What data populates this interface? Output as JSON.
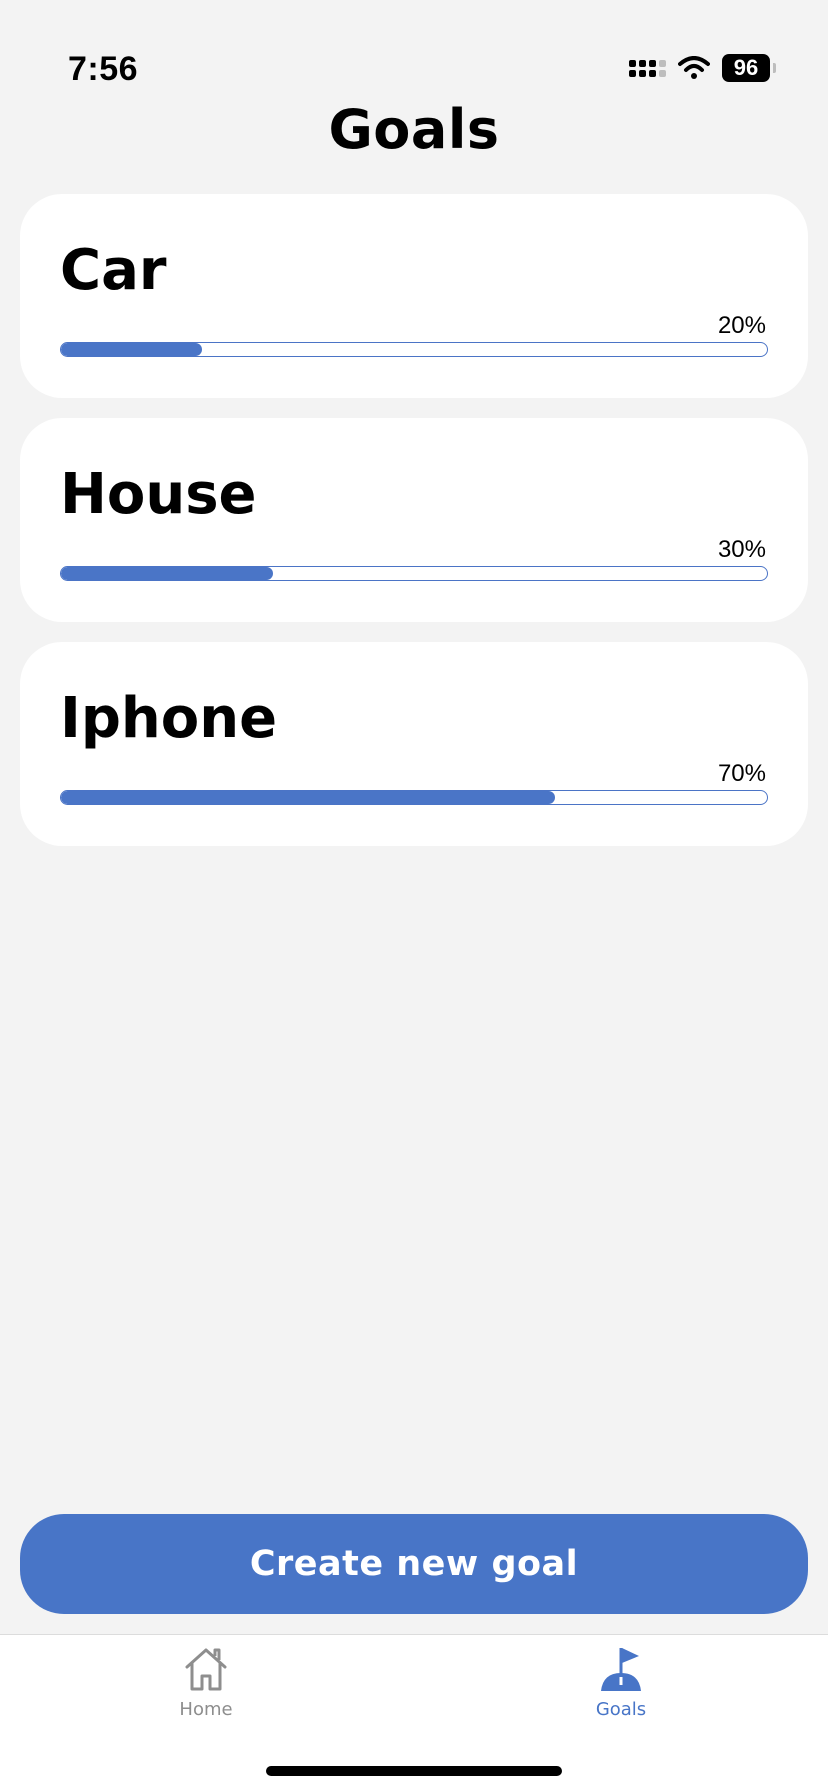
{
  "status_bar": {
    "time": "7:56",
    "battery": "96"
  },
  "header": {
    "title": "Goals"
  },
  "goals": [
    {
      "name": "Car",
      "percent_label": "20%",
      "progress": 0.2
    },
    {
      "name": "House",
      "percent_label": "30%",
      "progress": 0.3
    },
    {
      "name": "Iphone",
      "percent_label": "70%",
      "progress": 0.7
    }
  ],
  "create_button": {
    "label": "Create new goal"
  },
  "tabbar": {
    "tabs": [
      {
        "label": "Home",
        "icon": "house-icon",
        "active": false
      },
      {
        "label": "Goals",
        "icon": "flag-icon",
        "active": true
      }
    ]
  },
  "colors": {
    "accent": "#4875c7",
    "background": "#f3f3f3",
    "card": "#ffffff",
    "inactive_tab": "#8e8e8e"
  }
}
